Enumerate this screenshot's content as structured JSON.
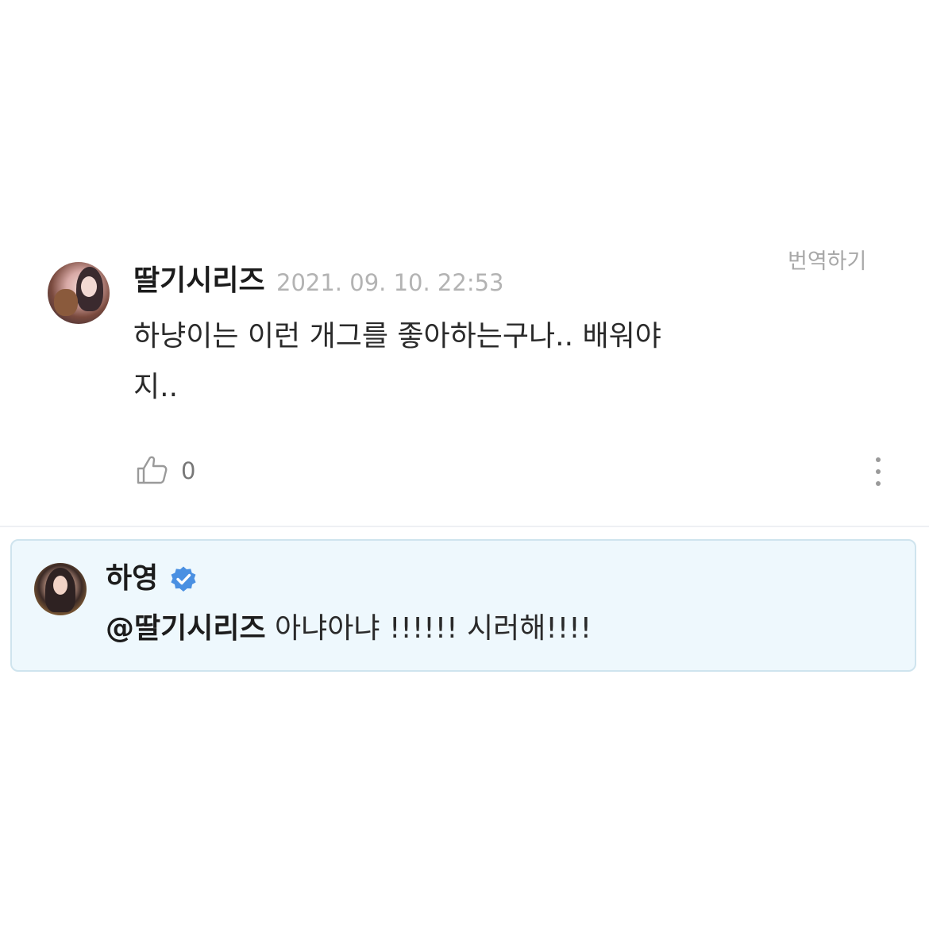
{
  "comment": {
    "username": "딸기시리즈",
    "timestamp": "2021. 09. 10. 22:53",
    "translate_label": "번역하기",
    "body_line1": "하냥이는 이런 개그를 좋아하는구나.. 배워야",
    "body_line2": "지..",
    "like_count": "0",
    "icons": {
      "like": "thumbs-up-icon",
      "more": "more-vertical-icon"
    }
  },
  "reply": {
    "username": "하영",
    "mention": "@딸기시리즈",
    "text": " 아냐아냐 !!!!!! 시러해!!!!",
    "icons": {
      "verified": "verified-badge-icon"
    }
  },
  "colors": {
    "reply_background": "#eef8fd",
    "reply_border": "#cfe4ee",
    "verified_badge": "#4a90e2",
    "timestamp": "#b3b3b3"
  }
}
